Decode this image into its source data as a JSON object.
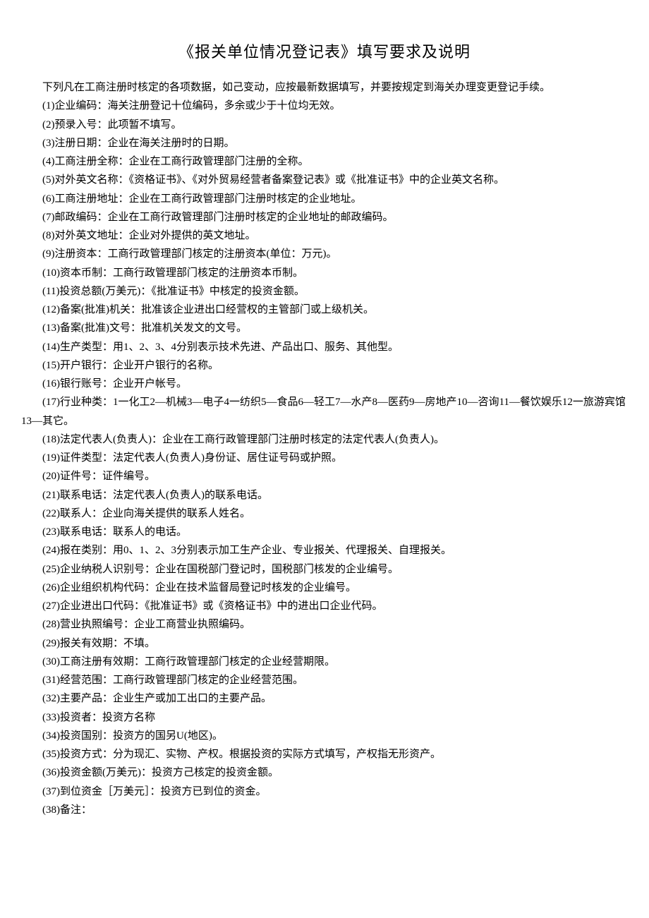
{
  "title": "《报关单位情况登记表》填写要求及说明",
  "intro": "下列凡在工商注册时核定的各项数据，如己变动，应按最新数据填写，并要按规定到海关办理变更登记手续。",
  "items": [
    "(1)企业编码：海关注册登记十位编码，多余或少于十位均无效。",
    "(2)预录入号：此项暂不填写。",
    "(3)注册日期：企业在海关注册时的日期。",
    "(4)工商注册全称：企业在工商行政管理部门注册的全称。",
    "(5)对外英文名称：《资格证书》、《对外贸易经营者备案登记表》或《批准证书》中的企业英文名称。",
    "(6)工商注册地址：企业在工商行政管理部门注册时核定的企业地址。",
    "(7)邮政编码：企业在工商行政管理部门注册时核定的企业地址的邮政编码。",
    "(8)对外英文地址：企业对外提供的英文地址。",
    "(9)注册资本：工商行政管理部门核定的注册资本(单位：万元)。",
    "(10)资本币制：工商行政管理部门核定的注册资本币制。",
    "(11)投资总额(万美元)：《批准证书》中核定的投资金额。",
    "(12)备案(批准)机关：批准该企业进出口经营权的主管部门或上级机关。",
    "(13)备案(批准)文号：批准机关发文的文号。",
    "(14)生产类型：用1、2、3、4分别表示技术先进、产品出口、服务、其他型。",
    "(15)开户银行：企业开户银行的名称。",
    "(16)银行账号：企业开户帐号。",
    "(17)行业种类：1一化工2—机械3—电子4一纺织5—食品6—轻工7—水产8—医药9—房地产10—咨询11—餐饮娱乐12一旅游宾馆13—其它。",
    "(18)法定代表人(负责人)：企业在工商行政管理部门注册时核定的法定代表人(负责人)。",
    "(19)证件类型：法定代表人(负责人)身份证、居住证号码或护照。",
    "(20)证件号：证件编号。",
    "(21)联系电话：法定代表人(负责人)的联系电话。",
    "(22)联系人：企业向海关提供的联系人姓名。",
    "(23)联系电话：联系人的电话。",
    "(24)报在类别：用0、1、2、3分别表示加工生产企业、专业报关、代理报关、自理报关。",
    "(25)企业纳税人识别号：企业在国税部门登记时，国税部门核发的企业编号。",
    "(26)企业组织机构代码：企业在技术监督局登记时核发的企业编号。",
    "(27)企业进出口代码：《批准证书》或《资格证书》中的进出口企业代码。",
    "(28)营业执照编号：企业工商营业执照编码。",
    "(29)报关有效期：不填。",
    "(30)工商注册有效期：工商行政管理部门核定的企业经营期限。",
    "(31)经营范围：工商行政管理部门核定的企业经营范围。",
    "(32)主要产品：企业生产或加工出口的主要产品。",
    "(33)投资者：投资方名称",
    "(34)投资国别：投资方的国另U(地区)。",
    "(35)投资方式：分为现汇、实物、产权。根据投资的实际方式填写，产权指无形资产。",
    "(36)投资金额(万美元)：投资方己核定的投资金额。",
    "(37)到位资金［万美元］：投资方已到位的资金。",
    "(38)备注："
  ]
}
